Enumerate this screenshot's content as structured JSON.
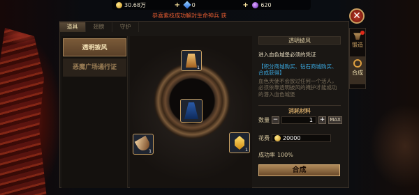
{
  "resources": [
    {
      "icon": "gold-coin-icon",
      "value": "30.68万"
    },
    {
      "icon": "diamond-icon",
      "value": "0"
    },
    {
      "icon": "purple-orb-icon",
      "value": "620"
    }
  ],
  "ticker": "恭喜紫枝成功解封生命神兵 获",
  "tabs": [
    "道具",
    "翅膀",
    "守护"
  ],
  "left_list": [
    "透明披风",
    "恶魔广场通行证"
  ],
  "slots": {
    "top_qty": "1",
    "left_qty": "1",
    "right_qty": "1"
  },
  "detail": {
    "title": "透明披风",
    "heading": "进入血色城堡必须的凭证",
    "blue": "【积分商城购买、钻石商城购买、合成获得】",
    "gray": "血色天使不会放过任何一个活人，必须依靠透明披风的掩护才能成功的潜入血色城堡"
  },
  "materials_title": "消耗材料",
  "quantity": {
    "label": "数量",
    "minus": "−",
    "value": "1",
    "plus": "+",
    "max": "MAX"
  },
  "cost": {
    "label": "花费",
    "value": "20000"
  },
  "rate": {
    "label": "成功率",
    "value": "100%"
  },
  "action": "合成",
  "side_tabs": [
    {
      "icon": "anvil-icon",
      "label": "锻造"
    },
    {
      "icon": "ring-icon",
      "label": "合成"
    }
  ],
  "close": "✕"
}
